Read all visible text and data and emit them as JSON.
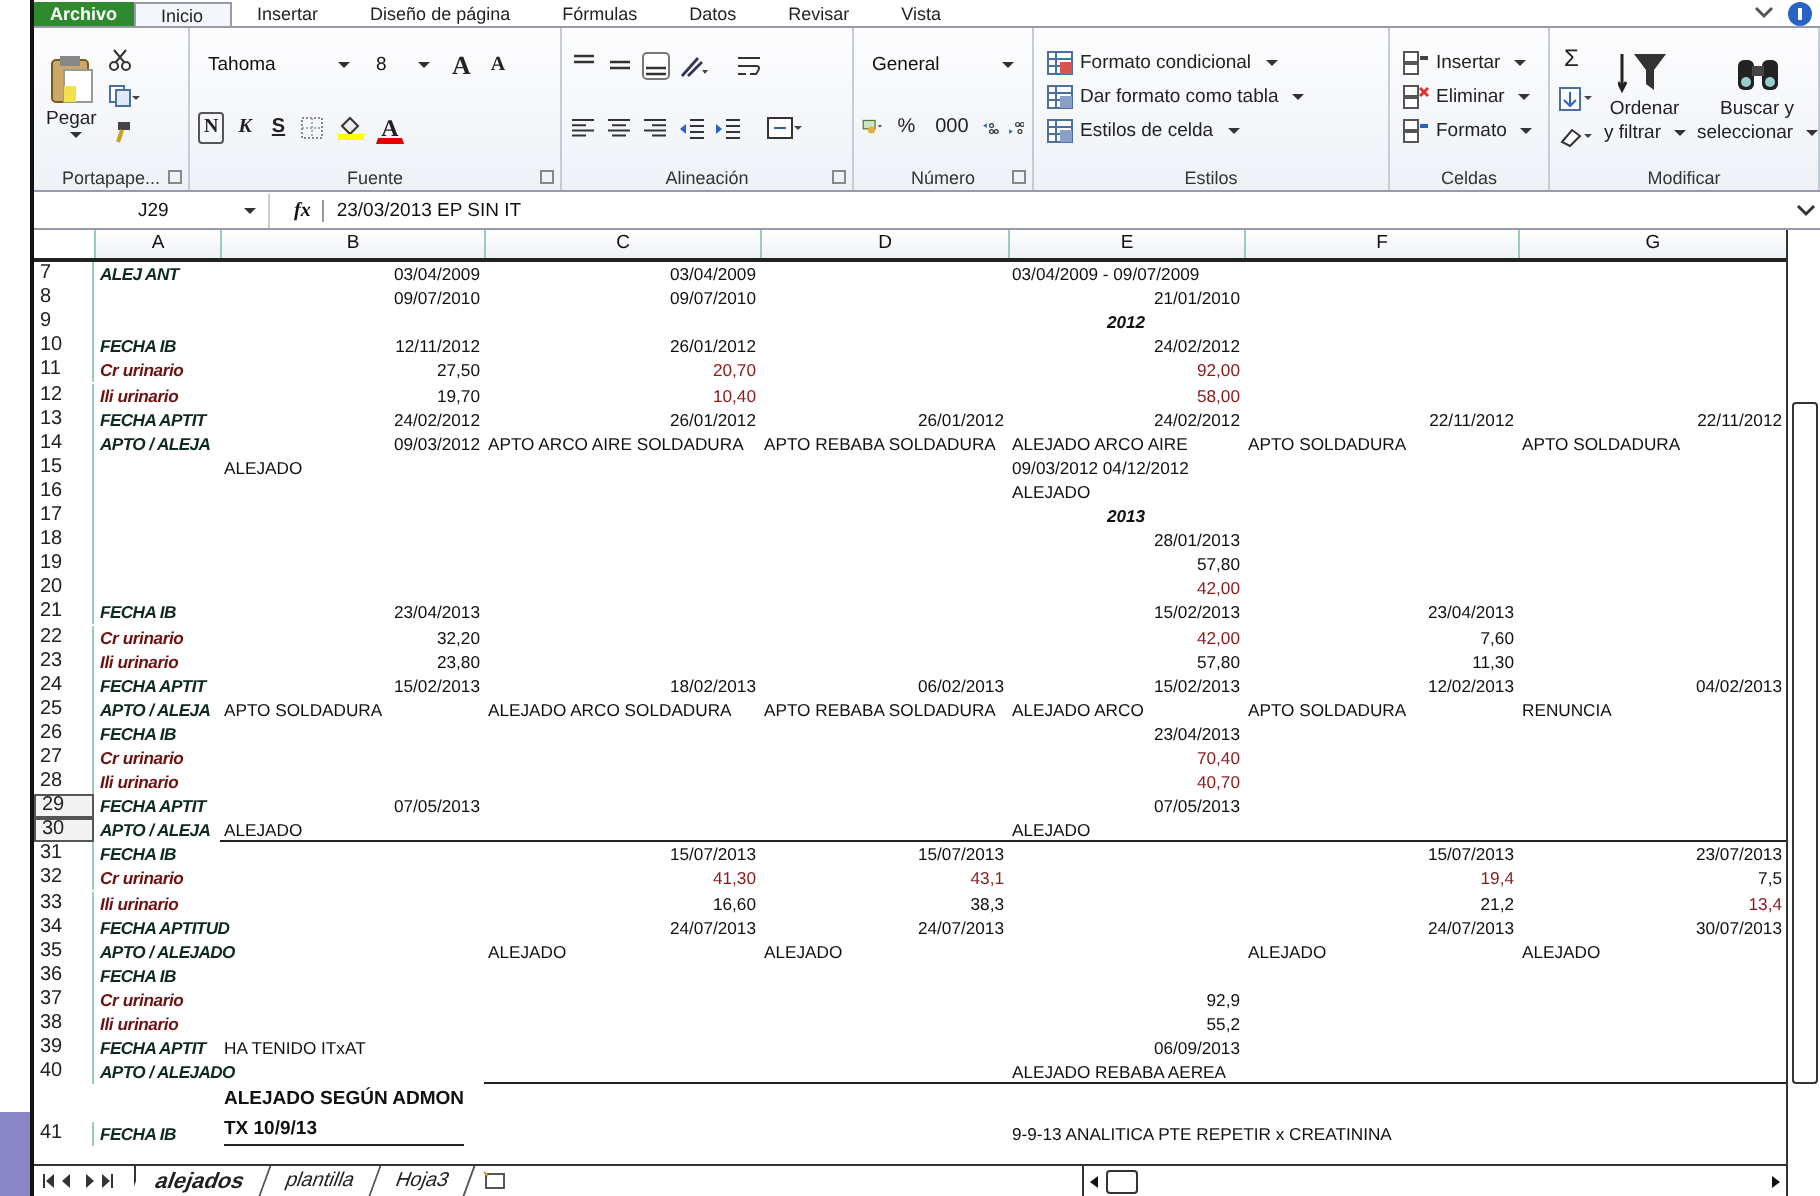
{
  "ribbon": {
    "tabs": [
      {
        "label": "Archivo",
        "kind": "file",
        "selected": false
      },
      {
        "label": "Inicio",
        "kind": "tab",
        "selected": true
      },
      {
        "label": "Insertar",
        "kind": "tab",
        "selected": false
      },
      {
        "label": "Diseño de página",
        "kind": "tab",
        "selected": false
      },
      {
        "label": "Fórmulas",
        "kind": "tab",
        "selected": false
      },
      {
        "label": "Datos",
        "kind": "tab",
        "selected": false
      },
      {
        "label": "Revisar",
        "kind": "tab",
        "selected": false
      },
      {
        "label": "Vista",
        "kind": "tab",
        "selected": false
      }
    ],
    "clipboard": {
      "paste": "Pegar",
      "label": "Portapape..."
    },
    "font": {
      "family": "Tahoma",
      "size": "8",
      "grow": "A",
      "shrink": "A",
      "bold": "N",
      "italic": "K",
      "underline": "S",
      "font_color_letter": "A",
      "label": "Fuente"
    },
    "alignment": {
      "label": "Alineación"
    },
    "number": {
      "format": "General",
      "percent": "%",
      "thousands": "000",
      "label": "Número"
    },
    "styles": {
      "items": [
        "Formato condicional",
        "Dar formato como tabla",
        "Estilos de celda"
      ],
      "label": "Estilos"
    },
    "cells": {
      "items": [
        "Insertar",
        "Eliminar",
        "Formato"
      ],
      "label": "Celdas"
    },
    "editing": {
      "sum": "Σ",
      "sort": [
        "Ordenar",
        "y filtrar"
      ],
      "find": [
        "Buscar y",
        "seleccionar"
      ],
      "label": "Modificar"
    }
  },
  "formula_bar": {
    "name_box": "J29",
    "fx": "fx",
    "formula": "23/03/2013 EP SIN IT"
  },
  "sheet": {
    "columns": [
      "A",
      "B",
      "C",
      "D",
      "E",
      "F",
      "G"
    ],
    "rows": [
      {
        "number": "7",
        "selected": false,
        "cells": {
          "A": {
            "kind": "label",
            "text": "ALEJ ANT"
          },
          "B": {
            "kind": "value",
            "text": "03/04/2009"
          },
          "C": {
            "kind": "value",
            "text": "03/04/2009"
          },
          "E": {
            "kind": "text",
            "text": "03/04/2009 - 09/07/2009"
          }
        }
      },
      {
        "number": "8",
        "selected": false,
        "cells": {
          "B": {
            "kind": "value",
            "text": "09/07/2010"
          },
          "C": {
            "kind": "value",
            "text": "09/07/2010"
          },
          "E": {
            "kind": "value",
            "text": "21/01/2010"
          }
        }
      },
      {
        "number": "9",
        "selected": false,
        "cells": {
          "E": {
            "kind": "year",
            "text": "2012"
          }
        }
      },
      {
        "number": "10",
        "selected": false,
        "cells": {
          "A": {
            "kind": "label",
            "text": "FECHA IB"
          },
          "B": {
            "kind": "value",
            "text": "12/11/2012"
          },
          "C": {
            "kind": "value",
            "text": "26/01/2012"
          },
          "E": {
            "kind": "value",
            "text": "24/02/2012"
          }
        }
      },
      {
        "number": "11",
        "selected": false,
        "cells": {
          "A": {
            "kind": "label_alt",
            "text": "Cr urinario"
          },
          "B": {
            "kind": "value",
            "text": "27,50"
          },
          "C": {
            "kind": "value_red",
            "text": "20,70"
          },
          "E": {
            "kind": "value_red",
            "text": "92,00"
          }
        }
      },
      {
        "number": "12",
        "selected": false,
        "cells": {
          "A": {
            "kind": "label_alt",
            "text": "Ili urinario"
          },
          "B": {
            "kind": "value",
            "text": "19,70"
          },
          "C": {
            "kind": "value_red",
            "text": "10,40"
          },
          "E": {
            "kind": "value_red",
            "text": "58,00"
          }
        }
      },
      {
        "number": "13",
        "selected": false,
        "cells": {
          "A": {
            "kind": "label",
            "text": "FECHA APTIT"
          },
          "B": {
            "kind": "value",
            "text": "24/02/2012"
          },
          "C": {
            "kind": "value",
            "text": "26/01/2012"
          },
          "D": {
            "kind": "value",
            "text": "26/01/2012"
          },
          "E": {
            "kind": "value",
            "text": "24/02/2012"
          },
          "F": {
            "kind": "value",
            "text": "22/11/2012"
          },
          "G": {
            "kind": "value",
            "text": "22/11/2012"
          }
        }
      },
      {
        "number": "14",
        "selected": false,
        "cells": {
          "A": {
            "kind": "label",
            "text": "APTO / ALEJA"
          },
          "B": {
            "kind": "value",
            "text": "09/03/2012"
          },
          "C": {
            "kind": "text",
            "text": "APTO ARCO AIRE SOLDADURA"
          },
          "D": {
            "kind": "text",
            "text": "APTO REBABA SOLDADURA"
          },
          "E": {
            "kind": "text",
            "text": "ALEJADO ARCO AIRE"
          },
          "F": {
            "kind": "text",
            "text": "APTO SOLDADURA"
          },
          "G": {
            "kind": "text",
            "text": "APTO SOLDADURA"
          }
        }
      },
      {
        "number": "15",
        "selected": false,
        "cells": {
          "B": {
            "kind": "text",
            "text": "ALEJADO"
          },
          "E": {
            "kind": "text",
            "text": "09/03/2012  04/12/2012"
          }
        }
      },
      {
        "number": "16",
        "selected": false,
        "cells": {
          "E": {
            "kind": "text",
            "text": "ALEJADO"
          }
        }
      },
      {
        "number": "17",
        "selected": false,
        "cells": {
          "E": {
            "kind": "year",
            "text": "2013"
          }
        }
      },
      {
        "number": "18",
        "selected": false,
        "cells": {
          "E": {
            "kind": "value",
            "text": "28/01/2013"
          }
        }
      },
      {
        "number": "19",
        "selected": false,
        "cells": {
          "E": {
            "kind": "value",
            "text": "57,80"
          }
        }
      },
      {
        "number": "20",
        "selected": false,
        "cells": {
          "E": {
            "kind": "value_red",
            "text": "42,00"
          }
        }
      },
      {
        "number": "21",
        "selected": false,
        "cells": {
          "A": {
            "kind": "label",
            "text": "FECHA IB"
          },
          "B": {
            "kind": "value",
            "text": "23/04/2013"
          },
          "E": {
            "kind": "value",
            "text": "15/02/2013"
          },
          "F": {
            "kind": "value",
            "text": "23/04/2013"
          }
        }
      },
      {
        "number": "22",
        "selected": false,
        "cells": {
          "A": {
            "kind": "label_alt",
            "text": "Cr urinario"
          },
          "B": {
            "kind": "value",
            "text": "32,20"
          },
          "E": {
            "kind": "value_red",
            "text": "42,00"
          },
          "F": {
            "kind": "value",
            "text": "7,60"
          }
        }
      },
      {
        "number": "23",
        "selected": false,
        "cells": {
          "A": {
            "kind": "label_alt",
            "text": "Ili urinario"
          },
          "B": {
            "kind": "value",
            "text": "23,80"
          },
          "E": {
            "kind": "value",
            "text": "57,80"
          },
          "F": {
            "kind": "value",
            "text": "11,30"
          }
        }
      },
      {
        "number": "24",
        "selected": false,
        "cells": {
          "A": {
            "kind": "label",
            "text": "FECHA APTIT"
          },
          "B": {
            "kind": "value",
            "text": "15/02/2013"
          },
          "C": {
            "kind": "value",
            "text": "18/02/2013"
          },
          "D": {
            "kind": "value",
            "text": "06/02/2013"
          },
          "E": {
            "kind": "value",
            "text": "15/02/2013"
          },
          "F": {
            "kind": "value",
            "text": "12/02/2013"
          },
          "G": {
            "kind": "value",
            "text": "04/02/2013"
          }
        }
      },
      {
        "number": "25",
        "selected": false,
        "cells": {
          "A": {
            "kind": "label",
            "text": "APTO / ALEJA"
          },
          "B": {
            "kind": "text",
            "text": "APTO SOLDADURA"
          },
          "C": {
            "kind": "text",
            "text": "ALEJADO ARCO SOLDADURA"
          },
          "D": {
            "kind": "text",
            "text": "APTO REBABA SOLDADURA"
          },
          "E": {
            "kind": "text",
            "text": "ALEJADO ARCO"
          },
          "F": {
            "kind": "text",
            "text": "APTO SOLDADURA"
          },
          "G": {
            "kind": "text",
            "text": "RENUNCIA"
          }
        }
      },
      {
        "number": "26",
        "selected": false,
        "cells": {
          "A": {
            "kind": "label",
            "text": "FECHA IB"
          },
          "E": {
            "kind": "value",
            "text": "23/04/2013"
          }
        }
      },
      {
        "number": "27",
        "selected": false,
        "cells": {
          "A": {
            "kind": "label_alt",
            "text": "Cr urinario"
          },
          "E": {
            "kind": "value_red",
            "text": "70,40"
          }
        }
      },
      {
        "number": "28",
        "selected": false,
        "cells": {
          "A": {
            "kind": "label_alt",
            "text": "Ili urinario"
          },
          "E": {
            "kind": "value_red",
            "text": "40,70"
          }
        }
      },
      {
        "number": "29",
        "selected": true,
        "cells": {
          "A": {
            "kind": "label",
            "text": "FECHA APTIT"
          },
          "B": {
            "kind": "value",
            "text": "07/05/2013"
          },
          "E": {
            "kind": "value",
            "text": "07/05/2013"
          }
        }
      },
      {
        "number": "30",
        "selected": true,
        "cells": {
          "A": {
            "kind": "label",
            "text": "APTO / ALEJA"
          },
          "B": {
            "kind": "text",
            "text": "ALEJADO",
            "border_below": true
          },
          "E": {
            "kind": "text",
            "text": "ALEJADO"
          }
        }
      },
      {
        "number": "31",
        "selected": false,
        "cells": {
          "A": {
            "kind": "label",
            "text": "FECHA IB"
          },
          "C": {
            "kind": "value",
            "text": "15/07/2013"
          },
          "D": {
            "kind": "value",
            "text": "15/07/2013"
          },
          "F": {
            "kind": "value",
            "text": "15/07/2013"
          },
          "G": {
            "kind": "value",
            "text": "23/07/2013"
          }
        }
      },
      {
        "number": "32",
        "selected": false,
        "cells": {
          "A": {
            "kind": "label_alt",
            "text": "Cr urinario"
          },
          "C": {
            "kind": "value_red",
            "text": "41,30"
          },
          "D": {
            "kind": "value_red",
            "text": "43,1"
          },
          "F": {
            "kind": "value_red",
            "text": "19,4"
          },
          "G": {
            "kind": "value",
            "text": "7,5"
          }
        }
      },
      {
        "number": "33",
        "selected": false,
        "cells": {
          "A": {
            "kind": "label_alt",
            "text": "Ili urinario"
          },
          "C": {
            "kind": "value",
            "text": "16,60"
          },
          "D": {
            "kind": "value",
            "text": "38,3"
          },
          "F": {
            "kind": "value",
            "text": "21,2"
          },
          "G": {
            "kind": "value_red",
            "text": "13,4"
          }
        }
      },
      {
        "number": "34",
        "selected": false,
        "cells": {
          "A": {
            "kind": "label",
            "text": "FECHA APTITUD"
          },
          "C": {
            "kind": "value",
            "text": "24/07/2013"
          },
          "D": {
            "kind": "value",
            "text": "24/07/2013"
          },
          "F": {
            "kind": "value",
            "text": "24/07/2013"
          },
          "G": {
            "kind": "value",
            "text": "30/07/2013"
          }
        }
      },
      {
        "number": "35",
        "selected": false,
        "cells": {
          "A": {
            "kind": "label",
            "text": "APTO / ALEJADO"
          },
          "C": {
            "kind": "text",
            "text": "ALEJADO"
          },
          "D": {
            "kind": "text",
            "text": "ALEJADO"
          },
          "F": {
            "kind": "text",
            "text": "ALEJADO"
          },
          "G": {
            "kind": "text",
            "text": "ALEJADO"
          }
        }
      },
      {
        "number": "36",
        "selected": false,
        "cells": {
          "A": {
            "kind": "label",
            "text": "FECHA IB"
          }
        }
      },
      {
        "number": "37",
        "selected": false,
        "cells": {
          "A": {
            "kind": "label_alt",
            "text": "Cr urinario"
          },
          "E": {
            "kind": "value",
            "text": "92,9"
          }
        }
      },
      {
        "number": "38",
        "selected": false,
        "cells": {
          "A": {
            "kind": "label_alt",
            "text": "Ili urinario"
          },
          "E": {
            "kind": "value",
            "text": "55,2"
          }
        }
      },
      {
        "number": "39",
        "selected": false,
        "cells": {
          "A": {
            "kind": "label",
            "text": "FECHA APTIT"
          },
          "B": {
            "kind": "text",
            "text": "HA TENIDO ITxAT"
          },
          "E": {
            "kind": "value",
            "text": "06/09/2013"
          }
        }
      },
      {
        "number": "40",
        "selected": false,
        "cells": {
          "A": {
            "kind": "label",
            "text": "APTO / ALEJADO"
          },
          "C": {
            "kind": "empty",
            "border_below": true
          },
          "E": {
            "kind": "text",
            "text": "ALEJADO REBABA AEREA"
          }
        }
      },
      {
        "number": "41",
        "selected": false,
        "cells": {
          "A": {
            "kind": "label",
            "text": "FECHA IB"
          },
          "B": {
            "kind": "note",
            "text": "ALEJADO SEGÚN ADMON\nTX 10/9/13"
          },
          "E": {
            "kind": "text",
            "text": "9-9-13 ANALITICA PTE REPETIR x CREATININA"
          }
        }
      }
    ]
  },
  "sheet_tabs": [
    {
      "label": "alejados",
      "selected": true
    },
    {
      "label": "plantilla",
      "selected": false
    },
    {
      "label": "Hoja3",
      "selected": false
    }
  ]
}
